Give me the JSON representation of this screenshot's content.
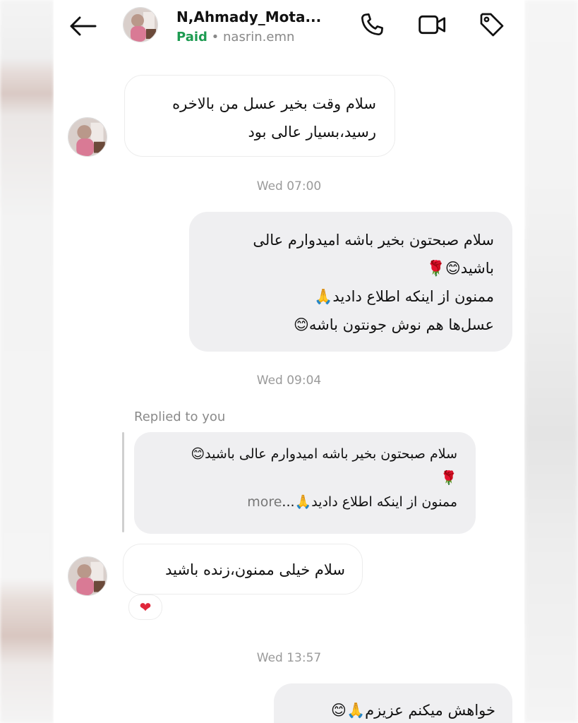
{
  "header": {
    "title": "N,Ahmady_Mota...",
    "paid_label": "Paid",
    "separator": "•",
    "username": "nasrin.emn"
  },
  "messages": {
    "m1": {
      "line1": "سلام وقت بخیر عسل من بالاخره",
      "line2": "رسید،بسیار عالی بود"
    },
    "ts1": "Wed 07:00",
    "m2": {
      "line1": "سلام صبحتون بخیر باشه امیدوارم عالی",
      "line2": "باشید😊🌹",
      "line3": "ممنون از اینکه اطلاع دادید🙏",
      "line4": "عسل‌ها هم نوش جونتون باشه😊"
    },
    "ts2": "Wed 09:04",
    "replied_label": "Replied to you",
    "reply_quote": {
      "line1": "سلام صبحتون بخیر باشه امیدوارم عالی باشید😊",
      "line2": "🌹",
      "line3": "ممنون از اینکه اطلاع دادید🙏...",
      "more": "more"
    },
    "m3": {
      "line1": "سلام خیلی ممنون،زنده باشید"
    },
    "reaction": "❤",
    "ts3": "Wed 13:57",
    "m4": {
      "line1": "خواهش میکنم عزیزم🙏😊"
    }
  },
  "colors": {
    "paid": "#1d9b51",
    "bubble_out": "#efeff1",
    "heart": "#e0263a"
  },
  "icons": [
    "back-arrow-icon",
    "phone-icon",
    "video-call-icon",
    "tag-icon"
  ]
}
